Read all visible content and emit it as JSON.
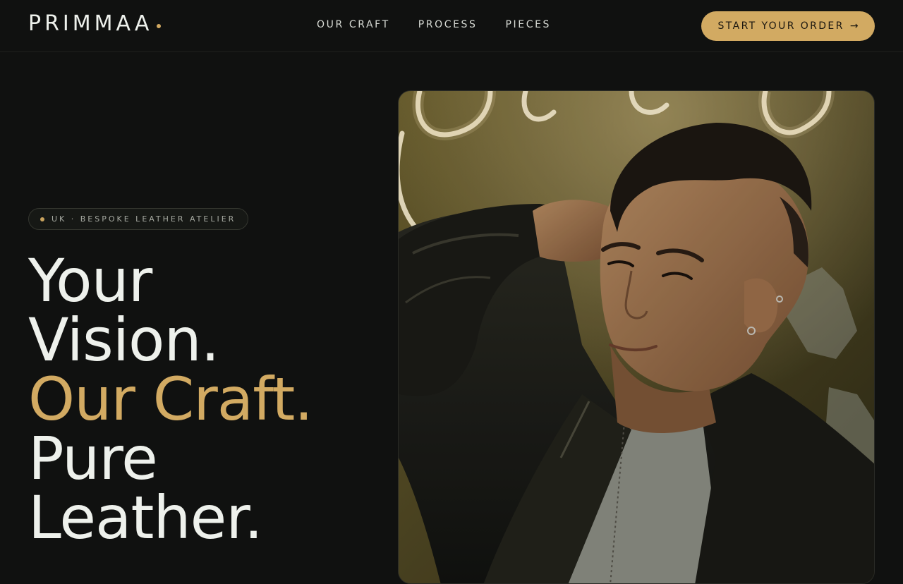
{
  "brand": {
    "name": "PRIMMAA"
  },
  "nav": {
    "items": [
      {
        "label": "OUR CRAFT"
      },
      {
        "label": "PROCESS"
      },
      {
        "label": "PIECES"
      }
    ]
  },
  "cta": {
    "label": "START YOUR ORDER",
    "arrow": "→"
  },
  "hero": {
    "badge": "UK · BESPOKE LEATHER ATELIER",
    "headline": {
      "line1": "Your",
      "line2": "Vision.",
      "line3": "Our Craft.",
      "line4": "Pure",
      "line5": "Leather."
    }
  },
  "colors": {
    "background": "#101110",
    "accent": "#d2aa62",
    "text": "#eef1ec"
  }
}
